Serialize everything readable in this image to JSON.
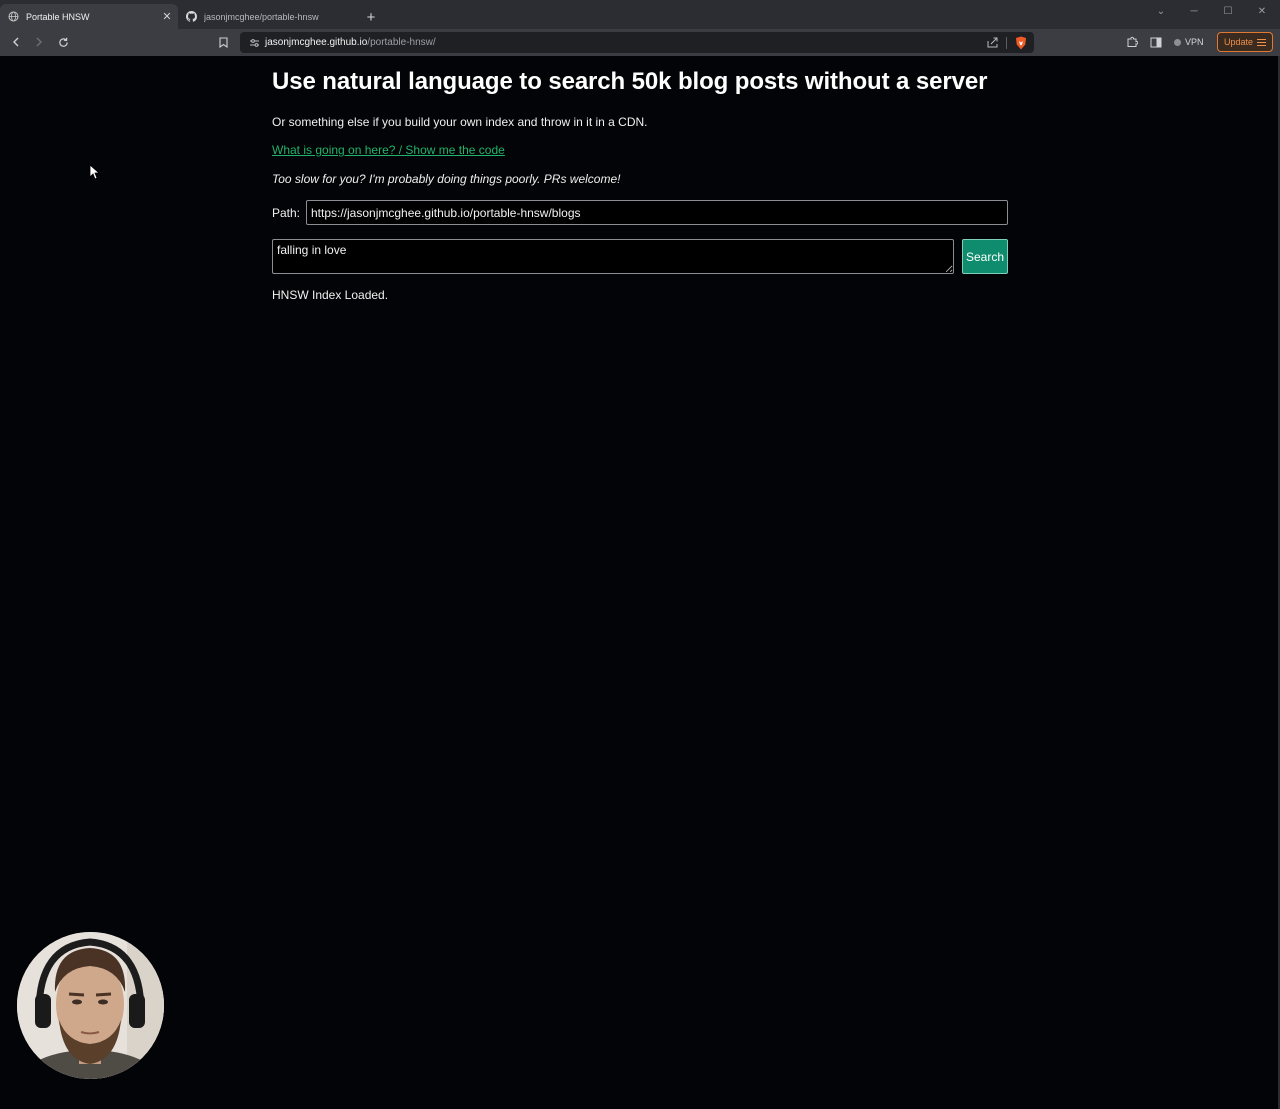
{
  "browser": {
    "tabs": [
      {
        "title": "Portable HNSW",
        "active": true,
        "icon": "globe-icon"
      },
      {
        "title": "jasonjmcghee/portable-hnsw",
        "active": false,
        "icon": "github-icon"
      }
    ],
    "new_tab_icon": "plus-icon",
    "address": {
      "domain": "jasonjmcghee.github.io",
      "path": "/portable-hnsw/"
    },
    "vpn_label": "VPN",
    "update_label": "Update",
    "accent_color": "#e07a32"
  },
  "page": {
    "heading": "Use natural language to search 50k blog posts without a server",
    "subtitle": "Or something else if you build your own index and throw in it in a CDN.",
    "link_text": "What is going on here? / Show me the code",
    "note": "Too slow for you? I'm probably doing things poorly. PRs welcome!",
    "path_label": "Path:",
    "path_value": "https://jasonjmcghee.github.io/portable-hnsw/blogs",
    "query_value": "falling in love",
    "search_label": "Search",
    "status": "HNSW Index Loaded.",
    "link_color": "#22b36a",
    "button_color": "#0f8c6d"
  }
}
